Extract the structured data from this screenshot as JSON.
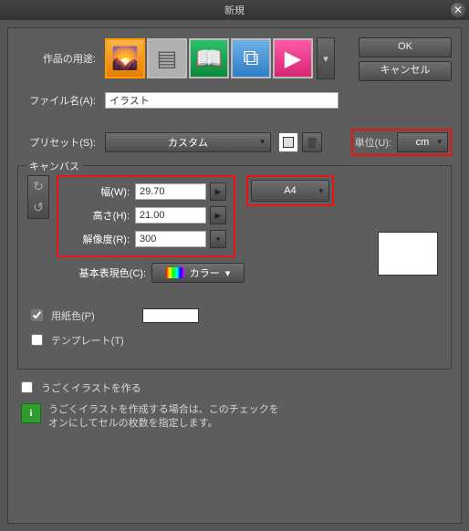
{
  "title": "新規",
  "buttons": {
    "ok": "OK",
    "cancel": "キャンセル"
  },
  "labels": {
    "purpose": "作品の用途:",
    "filename": "ファイル名(A):",
    "preset": "プリセット(S):",
    "unit": "単位(U):",
    "canvas": "キャンバス",
    "width": "幅(W):",
    "height": "高さ(H):",
    "resolution": "解像度(R):",
    "basecolor": "基本表現色(C):",
    "papercolor": "用紙色(P)",
    "template": "テンプレート(T)",
    "animate": "うごくイラストを作る",
    "hint": "うごくイラストを作成する場合は、このチェックをオンにしてセルの枚数を指定します。"
  },
  "values": {
    "filename": "イラスト",
    "preset": "カスタム",
    "unit": "cm",
    "width": "29.70",
    "height": "21.00",
    "resolution": "300",
    "size_preset": "A4",
    "basecolor": "カラー"
  },
  "checks": {
    "papercolor": true,
    "template": false,
    "animate": false
  },
  "icons": {
    "close": "✕",
    "dropdown": "▾",
    "right": "▶",
    "rotcw": "↻",
    "rotccw": "↺",
    "page": "▤",
    "trash": "🗑",
    "book": "📖",
    "frames": "⧉",
    "play": "▶"
  }
}
